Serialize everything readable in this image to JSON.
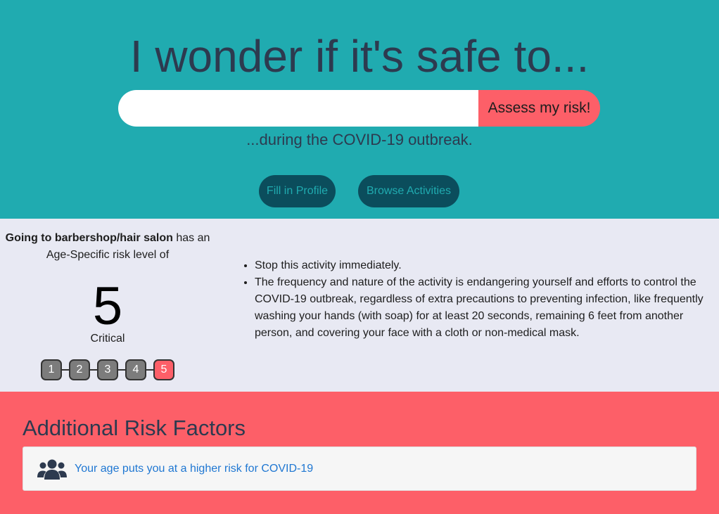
{
  "hero": {
    "title": "I wonder if it's safe to...",
    "search_value": "",
    "search_placeholder": "",
    "assess_label": "Assess my risk!",
    "subtitle": "...during the COVID-19 outbreak.",
    "fill_profile_label": "Fill in Profile",
    "browse_activities_label": "Browse Activities"
  },
  "risk": {
    "activity": "Going to barbershop/hair salon",
    "intro_suffix": " has an",
    "intro_line2": "Age-Specific risk level of",
    "level": "5",
    "level_label": "Critical",
    "scale": [
      "1",
      "2",
      "3",
      "4",
      "5"
    ],
    "active_level": 5,
    "advice": [
      "Stop this activity immediately.",
      "The frequency and nature of the activity is endangering yourself and efforts to control the COVID-19 outbreak, regardless of extra precautions to preventing infection, like frequently washing your hands (with soap) for at least 20 seconds, remaining 6 feet from another person, and covering your face with a cloth or non-medical mask."
    ]
  },
  "factors": {
    "title": "Additional Risk Factors",
    "items": [
      {
        "icon": "users-icon",
        "text": "Your age puts you at a higher risk for COVID-19"
      }
    ]
  },
  "colors": {
    "hero_bg": "#20abb0",
    "risk_bg": "#e8e9f3",
    "accent": "#fd5f68",
    "pill_bg": "#0b4d5c",
    "heading": "#2d3a4f",
    "link": "#1f77d2"
  }
}
